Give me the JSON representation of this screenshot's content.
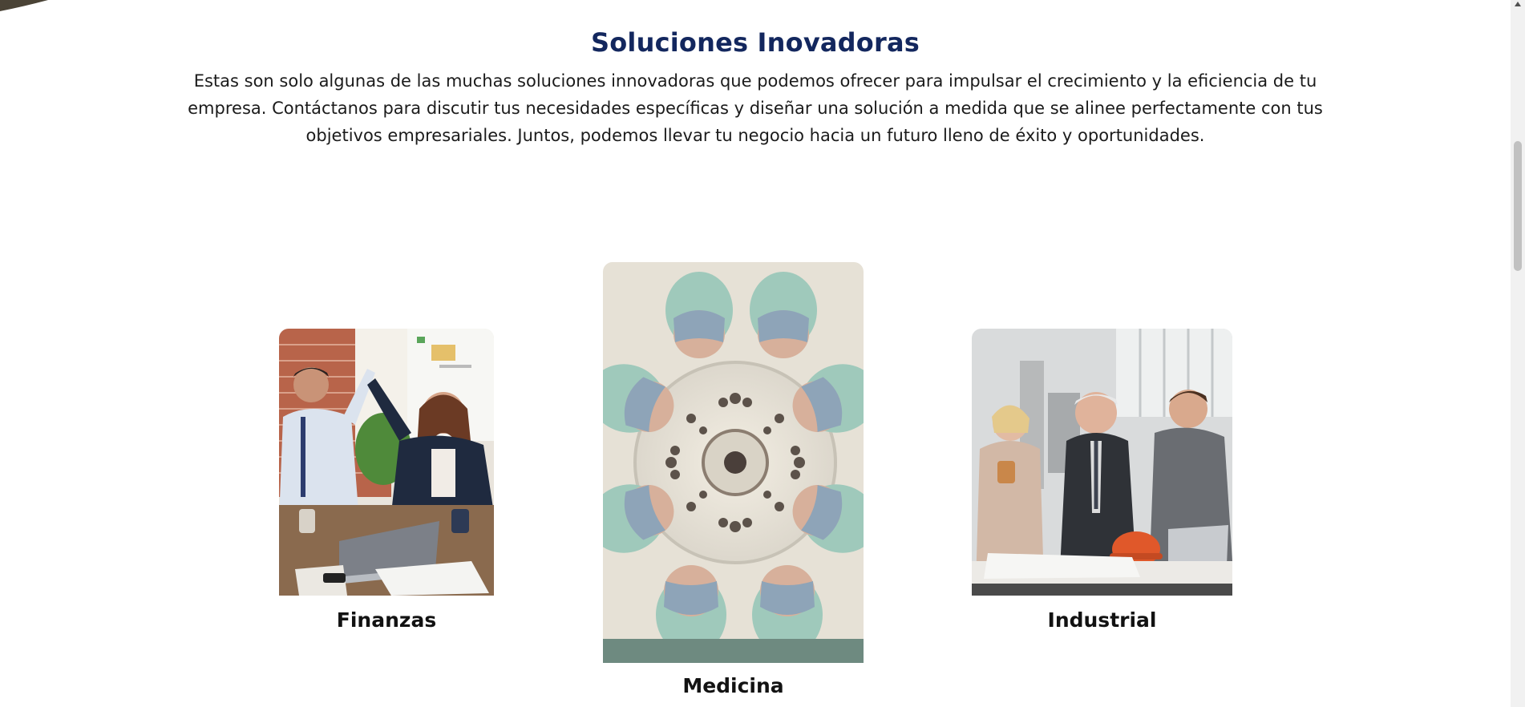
{
  "section": {
    "title": "Soluciones Inovadoras",
    "description": "Estas son solo algunas de las muchas soluciones innovadoras que podemos ofrecer para impulsar el crecimiento y la eficiencia de tu empresa. Contáctanos para discutir tus necesidades específicas y diseñar una solución a medida que se alinee perfectamente con tus objetivos empresariales. Juntos, podemos llevar tu negocio hacia un futuro lleno de éxito y oportunidades."
  },
  "cards": [
    {
      "label": "Finanzas",
      "image": "business-high-five-photo"
    },
    {
      "label": "Medicina",
      "image": "surgeons-circle-photo"
    },
    {
      "label": "Industrial",
      "image": "industrial-engineers-photo"
    }
  ],
  "colors": {
    "title": "#13275e",
    "text": "#1b1b1b"
  }
}
